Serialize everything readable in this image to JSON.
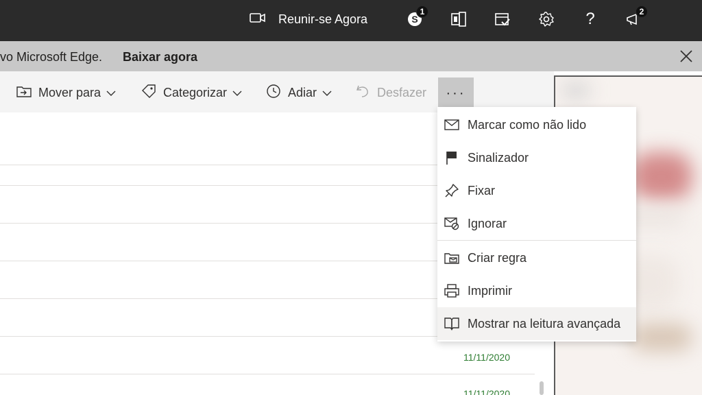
{
  "topbar": {
    "meet_now_label": "Reunir-se Agora",
    "skype_badge": "1",
    "feedback_badge": "2"
  },
  "banner": {
    "text": "vo Microsoft Edge.",
    "link": "Baixar agora"
  },
  "toolbar": {
    "move_to": "Mover para",
    "categorize": "Categorizar",
    "snooze": "Adiar",
    "undo": "Desfazer",
    "more": "···"
  },
  "menu": {
    "items": [
      {
        "label": "Marcar como não lido",
        "icon": "envelope-icon"
      },
      {
        "label": "Sinalizador",
        "icon": "flag-icon"
      },
      {
        "label": "Fixar",
        "icon": "pin-icon"
      },
      {
        "label": "Ignorar",
        "icon": "ignore-icon"
      },
      {
        "label": "Criar regra",
        "icon": "rule-icon"
      },
      {
        "label": "Imprimir",
        "icon": "printer-icon"
      },
      {
        "label": "Mostrar na leitura avançada",
        "icon": "immersive-reader-icon"
      }
    ]
  },
  "list": {
    "dates": [
      "11/11/2020",
      "11/11/2020"
    ]
  },
  "colors": {
    "topbar": "#2b2b2b",
    "banner": "#c8c8c8",
    "toolbar": "#f4f4f4",
    "date_green": "#2e7d32"
  }
}
